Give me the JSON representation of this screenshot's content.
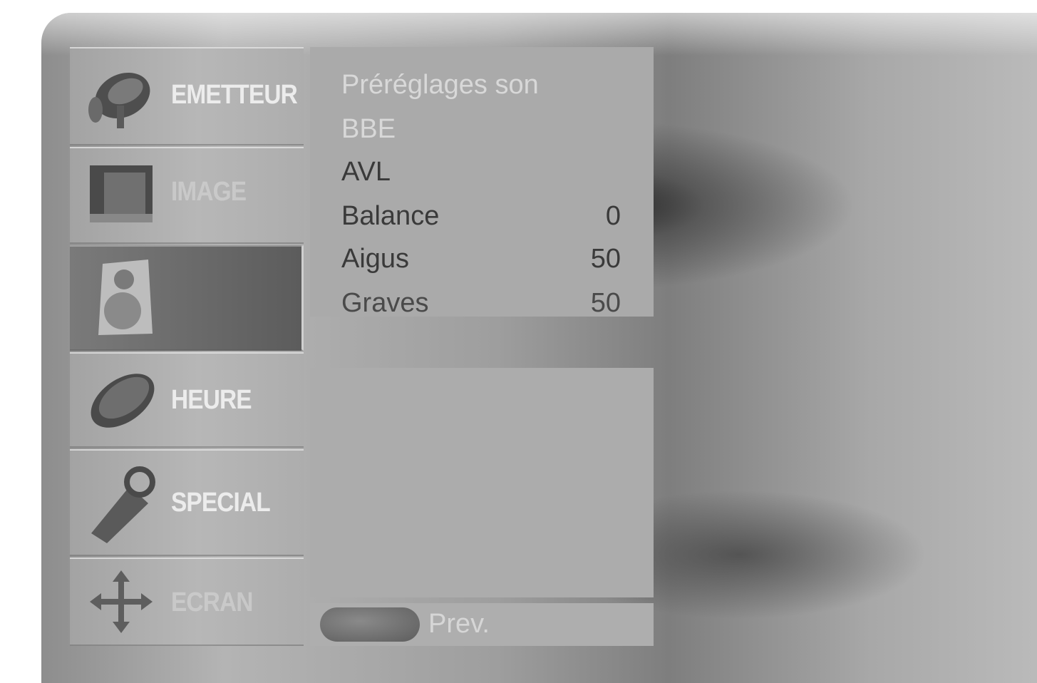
{
  "menu_tabs": [
    {
      "label": "EMETTEUR",
      "icon": "antenna-icon",
      "active": false
    },
    {
      "label": "IMAGE",
      "icon": "picture-icon",
      "active": false
    },
    {
      "label": "",
      "icon": "speaker-icon",
      "active": true
    },
    {
      "label": "HEURE",
      "icon": "clock-icon",
      "active": false
    },
    {
      "label": "SPECIAL",
      "icon": "key-tag-icon",
      "active": false
    },
    {
      "label": "ECRAN",
      "icon": "move-arrows-icon",
      "active": false
    }
  ],
  "sound_menu": {
    "items": [
      {
        "label": "Préréglages son",
        "value": ""
      },
      {
        "label": "BBE",
        "value": ""
      },
      {
        "label": "AVL",
        "value": ""
      },
      {
        "label": "Balance",
        "value": "0"
      },
      {
        "label": "Aigus",
        "value": "50"
      },
      {
        "label": "Graves",
        "value": "50"
      }
    ]
  },
  "footer": {
    "prev_label": "Prev."
  },
  "colors": {
    "panel_base": "#9e9e9e",
    "tab_bg": "#b0b0b0",
    "active_tab_bg": "#6a6a6a",
    "submenu_bg": "#aaaaaa",
    "text_dark": "#3a3a3a",
    "text_light": "#ececec"
  }
}
